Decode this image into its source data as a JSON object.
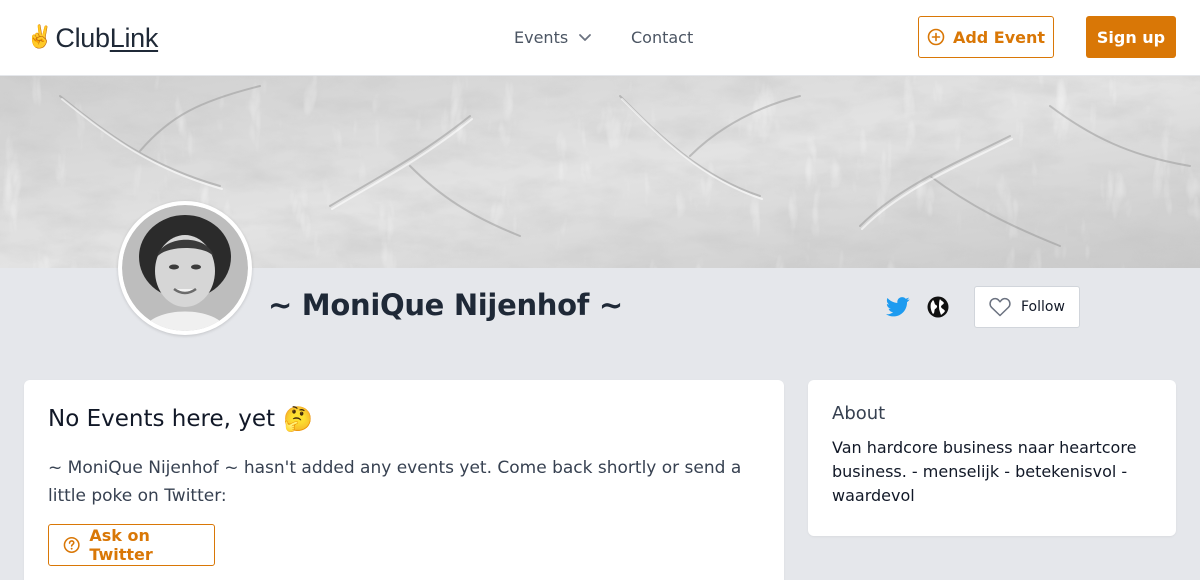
{
  "header": {
    "logo_emoji": "✌️",
    "logo_club": "Club",
    "logo_link": "Link",
    "nav": {
      "events_label": "Events",
      "contact_label": "Contact"
    },
    "add_event_label": "Add Event",
    "sign_up_label": "Sign up"
  },
  "profile": {
    "name": "~ MoniQue Nijenhof ~",
    "follow_label": "Follow",
    "social_icons": [
      "twitter-icon",
      "globe-icon"
    ]
  },
  "events_card": {
    "title": "No Events here, yet",
    "title_emoji": "🤔",
    "body": "~ MoniQue Nijenhof ~ hasn't added any events yet. Come back shortly or send a little poke on Twitter:",
    "ask_label": "Ask on Twitter"
  },
  "about_card": {
    "title": "About",
    "body": "Van hardcore business naar heartcore business. - menselijk - betekenisvol - waardevol"
  },
  "colors": {
    "accent": "#d97706",
    "twitter": "#1d9bf0",
    "page_bg": "#e5e7eb"
  }
}
